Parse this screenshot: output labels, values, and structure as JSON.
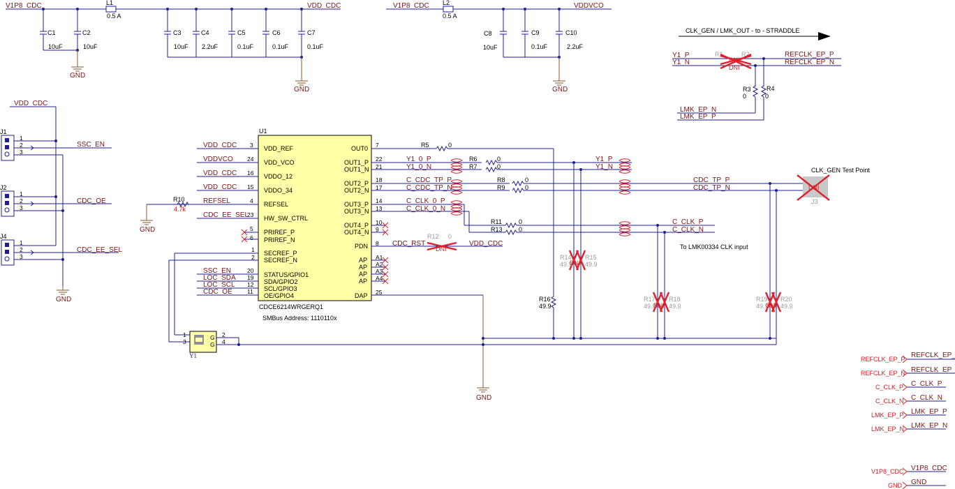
{
  "power": {
    "v1p8_left": "V1P8_CDC",
    "v1p8_right": "V1P8_CDC",
    "vdd_cdc": "VDD_CDC",
    "vddvco": "VDDVCO",
    "gnd": "GND"
  },
  "inductors": {
    "l1": {
      "ref": "L1",
      "val": "0.5 A"
    },
    "l2": {
      "ref": "L2",
      "val": "0.5 A"
    }
  },
  "caps": {
    "c1": {
      "ref": "C1",
      "val": "10uF"
    },
    "c2": {
      "ref": "C2",
      "val": "10uF"
    },
    "c3": {
      "ref": "C3",
      "val": "10uF"
    },
    "c4": {
      "ref": "C4",
      "val": "2.2uF"
    },
    "c5": {
      "ref": "C5",
      "val": "0.1uF"
    },
    "c6": {
      "ref": "C6",
      "val": "0.1uF"
    },
    "c7": {
      "ref": "C7",
      "val": "0.1uF"
    },
    "c8": {
      "ref": "C8",
      "val": "10uF"
    },
    "c9": {
      "ref": "C9",
      "val": "0.1uF"
    },
    "c10": {
      "ref": "C10",
      "val": "2.2uF"
    }
  },
  "straddle": {
    "title": "CLK_GEN / LMK_OUT - to - STRADDLE",
    "y1p": "Y1_P",
    "y1n": "Y1_N",
    "r1": "R1",
    "r2": "R2",
    "dni": "DNI",
    "refp": "REFCLK_EP_P",
    "refn": "REFCLK_EP_N",
    "r3": "R3",
    "r3v": "0",
    "r4": "R4",
    "r4v": "0",
    "lmkn": "LMK_EP_N",
    "lmkp": "LMK_EP_P"
  },
  "headers": {
    "vdd": "VDD_CDC",
    "j1": "J1",
    "j2": "J2",
    "j4": "J4",
    "pins": [
      "1",
      "2",
      "3"
    ],
    "ssc_en": "SSC_EN",
    "cdc_oe": "CDC_OE",
    "cdc_ee_sel": "CDC_EE_SEL"
  },
  "ic": {
    "ref": "U1",
    "part": "CDCE6214WRGERQ1",
    "smbus": "SMBus Address:  1110110x",
    "left_pins": [
      {
        "net": "VDD_CDC",
        "num": "3",
        "name": "VDD_REF"
      },
      {
        "net": "VDDVCO",
        "num": "24",
        "name": "VDD_VCO"
      },
      {
        "net": "VDD_CDC",
        "num": "16",
        "name": "VDDO_12"
      },
      {
        "net": "VDD_CDC",
        "num": "15",
        "name": "VDDO_34"
      },
      {
        "net": "REFSEL",
        "num": "4",
        "name": "REFSEL"
      },
      {
        "net": "CDC_EE_SEL",
        "num": "23",
        "name": "HW_SW_CTRL"
      },
      {
        "net": "",
        "num": "5",
        "name": "PRIREF_P"
      },
      {
        "net": "",
        "num": "6",
        "name": "PRIREF_N"
      },
      {
        "net": "",
        "num": "1",
        "name": "SECREF_P"
      },
      {
        "net": "",
        "num": "2",
        "name": "SECREF_N"
      },
      {
        "net": "SSC_EN",
        "num": "20",
        "name": "STATUS/GPIO1"
      },
      {
        "net": "LOC_SDA",
        "num": "19",
        "name": "SDA/GPIO2"
      },
      {
        "net": "LOC_SCL",
        "num": "12",
        "name": "SCL/GPIO3"
      },
      {
        "net": "CDC_OE",
        "num": "11",
        "name": "OE/GPIO4"
      }
    ],
    "right_pins": [
      {
        "name": "OUT0",
        "num": "7",
        "net": ""
      },
      {
        "name": "OUT1_P",
        "num": "22",
        "net": "Y1_0_P"
      },
      {
        "name": "OUT1_N",
        "num": "21",
        "net": "Y1_0_N"
      },
      {
        "name": "OUT2_P",
        "num": "18",
        "net": "C_CDC_TP_P"
      },
      {
        "name": "OUT2_N",
        "num": "17",
        "net": "C_CDC_TP_N"
      },
      {
        "name": "OUT3_P",
        "num": "14",
        "net": "C_CLK_0_P"
      },
      {
        "name": "OUT3_N",
        "num": "13",
        "net": "C_CLK_0_N"
      },
      {
        "name": "OUT4_P",
        "num": "10",
        "net": ""
      },
      {
        "name": "OUT4_N",
        "num": "9",
        "net": ""
      },
      {
        "name": "PDN",
        "num": "8",
        "net": "CDC_RST"
      },
      {
        "name": "AP",
        "num": "A1",
        "net": ""
      },
      {
        "name": "AP",
        "num": "A2",
        "net": ""
      },
      {
        "name": "AP",
        "num": "A3",
        "net": ""
      },
      {
        "name": "AP",
        "num": "A4",
        "net": ""
      },
      {
        "name": "DAP",
        "num": "25",
        "net": ""
      }
    ]
  },
  "refsel": {
    "ref": "R10",
    "val": "4.7k"
  },
  "resistors": {
    "r5": {
      "ref": "R5",
      "val": "0"
    },
    "r6": {
      "ref": "R6",
      "val": "0"
    },
    "r7": {
      "ref": "R7",
      "val": "0"
    },
    "r8": {
      "ref": "R8",
      "val": "0"
    },
    "r9": {
      "ref": "R9",
      "val": "0"
    },
    "r11": {
      "ref": "R11",
      "val": "0"
    },
    "r13": {
      "ref": "R13",
      "val": "0"
    },
    "r12": {
      "ref": "R12",
      "val": "0"
    },
    "r16": {
      "ref": "R16",
      "val": "49.9"
    },
    "r14": {
      "ref": "R14",
      "val": "49.9"
    },
    "r15": {
      "ref": "R15",
      "val": "49.9"
    },
    "r17": {
      "ref": "R17",
      "val": "49.9"
    },
    "r18": {
      "ref": "R18",
      "val": "49.9"
    },
    "r19": {
      "ref": "R19",
      "val": "49.9"
    },
    "r20": {
      "ref": "R20",
      "val": "49.9"
    }
  },
  "outputs": {
    "y1p": "Y1_P",
    "y1n": "Y1_N",
    "cdc_tp_p": "CDC_TP_P",
    "cdc_tp_n": "CDC_TP_N",
    "c_clk_p": "C_CLK_P",
    "c_clk_n": "C_CLK_N",
    "vdd_cdc": "VDD_CDC",
    "testpoint": "CLK_GEN Test Point",
    "j3": "J3",
    "lmk_note": "To LMK00334 CLK input"
  },
  "crystal": {
    "ref": "Y1",
    "p1": "1",
    "p2": "2",
    "p3": "3",
    "p4": "4",
    "g": "G"
  },
  "ports": [
    {
      "flag": "REFCLK_EP_P",
      "net": "REFCLK_EP_P"
    },
    {
      "flag": "REFCLK_EP_N",
      "net": "REFCLK_EP_N"
    },
    {
      "flag": "C_CLK_P",
      "net": "C_CLK_P"
    },
    {
      "flag": "C_CLK_N",
      "net": "C_CLK_N"
    },
    {
      "flag": "LMK_EP_P",
      "net": "LMK_EP_P"
    },
    {
      "flag": "LMK_EP_N",
      "net": "LMK_EP_N"
    },
    {
      "flag": "V1P8_CDC",
      "net": "V1P8_CDC"
    },
    {
      "flag": "GND",
      "net": "GND"
    }
  ]
}
